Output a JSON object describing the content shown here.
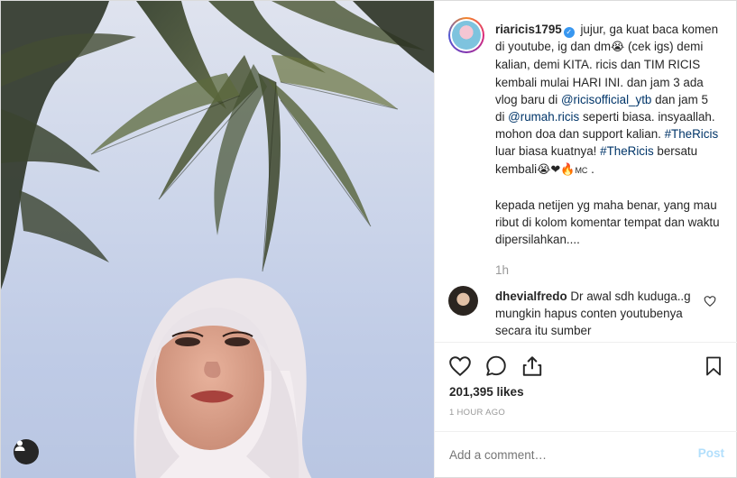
{
  "post": {
    "username": "riaricis1795",
    "caption_part1": " jujur, ga kuat baca komen di youtube, ig dan dm",
    "caption_part2": " (cek igs) demi kalian, demi KITA. ricis dan TIM RICIS kembali mulai HARI INI. dan jam 3 ada vlog baru di ",
    "mention_1": "@ricisofficial_ytb",
    "caption_part3": " dan jam 5 di ",
    "mention_2": "@rumah.ricis",
    "caption_part4": " seperti biasa. insyaallah. mohon doa dan support kalian. ",
    "hashtag_1": "#TheRicis",
    "caption_part5": " luar biasa kuatnya! ",
    "hashtag_2": "#TheRicis",
    "caption_part6": " bersatu kembali",
    "caption_emoji_end": "😭❤🔥",
    "caption_mc": "MC",
    "caption_period": " .",
    "caption_para2": "kepada netijen yg maha benar, yang mau ribut di kolom komentar tempat dan waktu dipersilahkan....",
    "time_ago": "1h",
    "emoji_cry": "😭"
  },
  "comment": {
    "username": "dhevialfredo",
    "text": " Dr awal sdh kuduga..g mungkin hapus conten youtubenya secara itu sumber"
  },
  "actions": {
    "like_icon": "heart-icon",
    "comment_icon": "comment-icon",
    "share_icon": "share-icon",
    "save_icon": "bookmark-icon",
    "likes_text": "201,395 likes",
    "posted_time": "1 HOUR AGO"
  },
  "add_comment": {
    "placeholder": "Add a comment…",
    "post_label": "Post"
  },
  "colors": {
    "link": "#003569",
    "muted": "#999999",
    "post_btn": "#b2dffc",
    "verified": "#3897f0"
  }
}
